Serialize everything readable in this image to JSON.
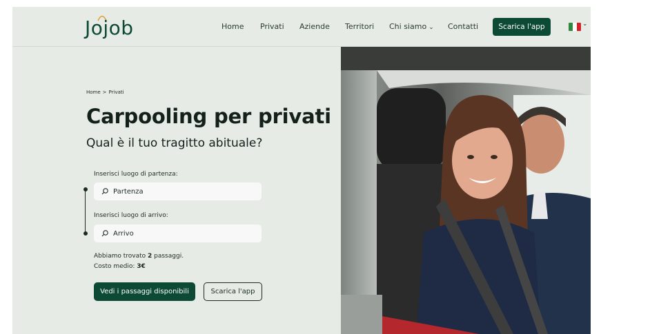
{
  "header": {
    "logo": "Jojob",
    "nav": [
      {
        "label": "Home"
      },
      {
        "label": "Privati"
      },
      {
        "label": "Aziende"
      },
      {
        "label": "Territori"
      },
      {
        "label": "Chi siamo",
        "has_dropdown": true
      },
      {
        "label": "Contatti"
      }
    ],
    "cta_label": "Scarica l'app",
    "language_flag": "flag-it-icon",
    "colors": {
      "brand": "#0c4a36",
      "background": "#e6ebe6"
    }
  },
  "breadcrumb": {
    "items": [
      "Home",
      "Privati"
    ],
    "separator": ">"
  },
  "hero": {
    "title": "Carpooling per privati",
    "subtitle": "Qual è il tuo tragitto abituale?",
    "departure_label": "Inserisci luogo di partenza:",
    "departure_placeholder": "Partenza",
    "arrival_label": "Inserisci luogo di arrivo:",
    "arrival_placeholder": "Arrivo",
    "result_prefix": "Abbiamo trovato ",
    "result_count": "2",
    "result_suffix": " passaggi.",
    "cost_prefix": "Costo medio: ",
    "cost_value": "3€",
    "primary_button": "Vedi i passaggi disponibili",
    "secondary_button": "Scarica l'app"
  }
}
